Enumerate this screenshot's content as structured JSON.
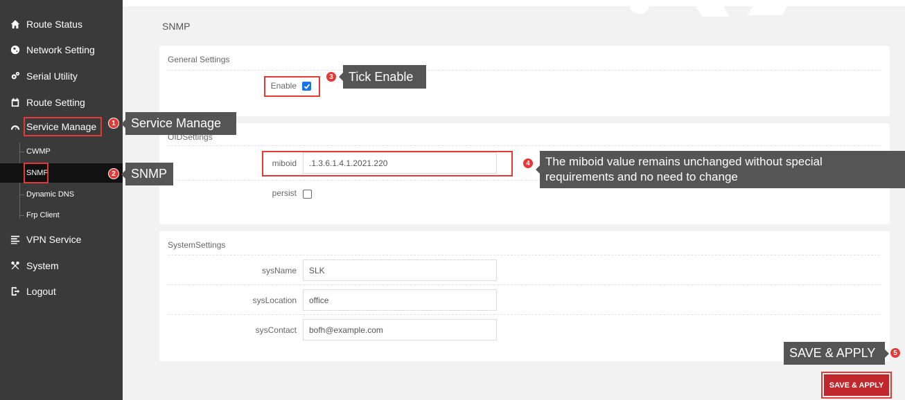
{
  "sidebar": {
    "items": [
      {
        "label": "Route Status",
        "icon": "home-icon"
      },
      {
        "label": "Network Setting",
        "icon": "globe-icon"
      },
      {
        "label": "Serial Utility",
        "icon": "gears-icon"
      },
      {
        "label": "Route Setting",
        "icon": "calendar-icon"
      },
      {
        "label": "Service Manage",
        "icon": "dashboard-icon"
      },
      {
        "label": "VPN Service",
        "icon": "list-icon"
      },
      {
        "label": "System",
        "icon": "tools-icon"
      },
      {
        "label": "Logout",
        "icon": "logout-icon"
      }
    ],
    "subitems": [
      {
        "label": "CWMP"
      },
      {
        "label": "SNMP"
      },
      {
        "label": "Dynamic DNS"
      },
      {
        "label": "Frp Client"
      }
    ]
  },
  "page": {
    "title": "SNMP"
  },
  "general": {
    "title": "General Settings",
    "enable_label": "Enable",
    "enable_checked": true
  },
  "oid": {
    "title": "OIDSettings",
    "miboid_label": "miboid",
    "miboid_value": ".1.3.6.1.4.1.2021.220",
    "persist_label": "persist",
    "persist_checked": false
  },
  "system": {
    "title": "SystemSettings",
    "sysname_label": "sysName",
    "sysname_value": "SLK",
    "syslocation_label": "sysLocation",
    "syslocation_value": "office",
    "syscontact_label": "sysContact",
    "syscontact_value": "bofh@example.com"
  },
  "save_button": "SAVE & APPLY",
  "annotations": {
    "step1": {
      "num": "1",
      "text": "Service Manage"
    },
    "step2": {
      "num": "2",
      "text": "SNMP"
    },
    "step3": {
      "num": "3",
      "text": "Tick Enable"
    },
    "step4": {
      "num": "4",
      "line1": "The miboid value remains unchanged without special",
      "line2": "requirements and no need to change"
    },
    "step5": {
      "num": "5",
      "text": "SAVE & APPLY"
    }
  },
  "colors": {
    "sidebar_bg": "#3a3a3a",
    "accent_red": "#c0272d",
    "annotation_red": "#e53935",
    "checkbox_blue": "#1a73e8"
  }
}
